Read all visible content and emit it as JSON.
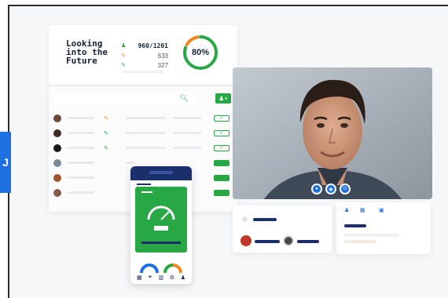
{
  "side_tab": {
    "label": "J"
  },
  "stats": {
    "title": "Looking into the Future",
    "rows": [
      {
        "icon": "user-icon",
        "value": "960/1201"
      },
      {
        "icon": "phone-icon",
        "value": "633"
      },
      {
        "icon": "phone-icon",
        "value": "327"
      }
    ],
    "percent_label": "80%",
    "percent": 0.8
  },
  "table": {
    "rows": 6
  },
  "colors": {
    "green": "#27a844",
    "navy": "#1b2f6b",
    "blue": "#1e6fe0",
    "orange": "#f08a1c"
  }
}
